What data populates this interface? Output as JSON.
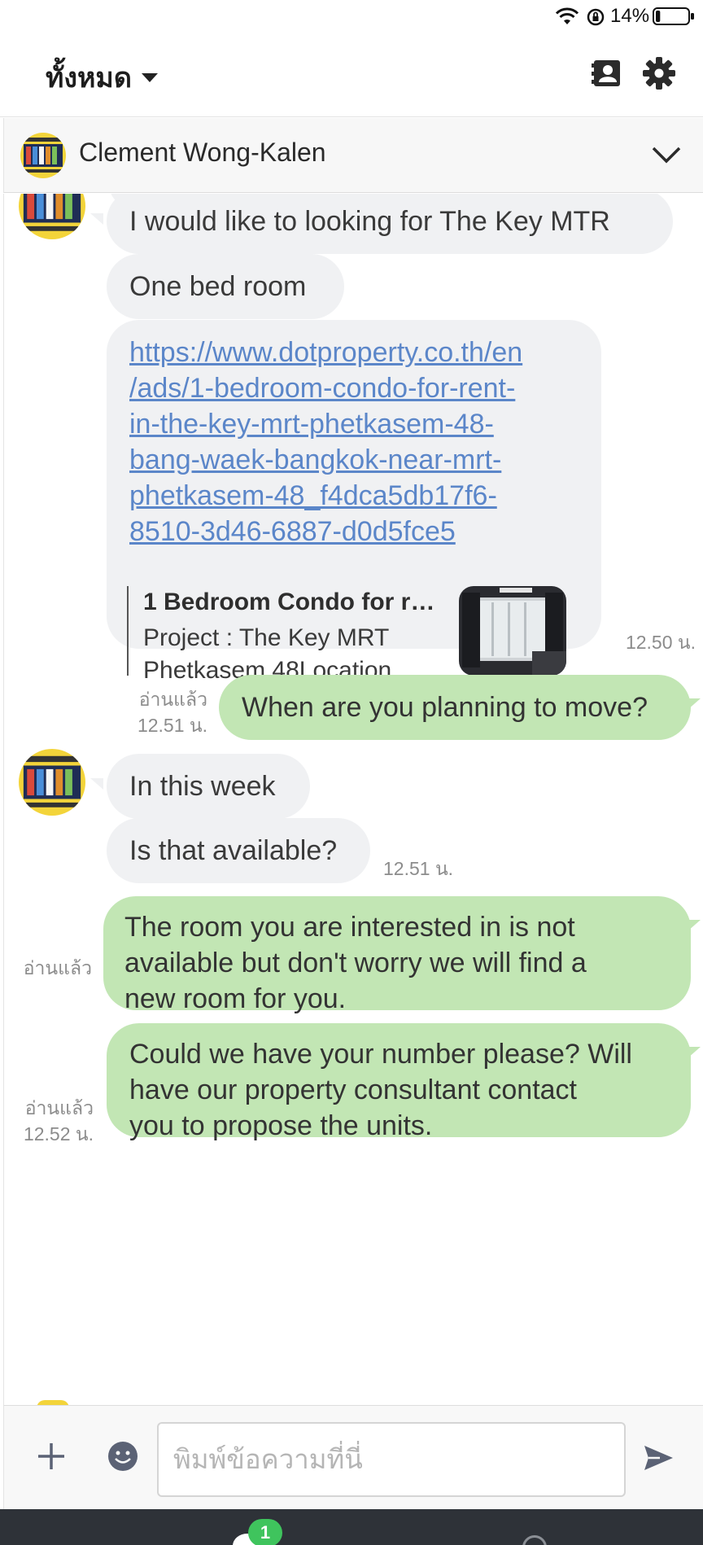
{
  "status_bar": {
    "battery_percent": "14%",
    "battery_level": 0.14
  },
  "header": {
    "filter_label": "ทั้งหมด",
    "icons": [
      "contacts-icon",
      "settings-gear-icon"
    ]
  },
  "conversation": {
    "contact_name": "Clement Wong-Kalen"
  },
  "messages": [
    {
      "side": "in",
      "text": "I would like to looking for The Key MTR"
    },
    {
      "side": "in",
      "text": "One bed room"
    },
    {
      "side": "in",
      "link": "https://www.dotproperty.co.th/en/ads/1-bedroom-condo-for-rent-in-the-key-mrt-phetkasem-48-bang-waek-bangkok-near-mrt-phetkasem-48_f4dca5db17f6-8510-3d46-6887-d0d5fce5",
      "link_lines": [
        "https://www.dotproperty.co.th/en",
        "/ads/1-bedroom-condo-for-rent-",
        "in-the-key-mrt-phetkasem-48-",
        "bang-waek-bangkok-near-mrt-",
        "phetkasem-48_f4dca5db17f6-",
        "8510-3d46-6887-d0d5fce5"
      ],
      "preview_title": "1 Bedroom Condo for r…",
      "preview_desc_1": "Project : The Key MRT",
      "preview_desc_2": "Phetkasem 48Location…",
      "time": "12.50 น."
    },
    {
      "side": "out",
      "text": "When are you planning to move?",
      "read": "อ่านแล้ว",
      "time": "12.51 น."
    },
    {
      "side": "in",
      "text": "In this week"
    },
    {
      "side": "in",
      "text": "Is that available?",
      "time": "12.51 น."
    },
    {
      "side": "out",
      "lines": [
        "The room you are interested in is not",
        "available but don't worry we will find a",
        "new room for you."
      ],
      "read": "อ่านแล้ว"
    },
    {
      "side": "out",
      "lines": [
        "Could we have your number please? Will",
        "have our property consultant contact",
        "you to propose the units."
      ],
      "read": "อ่านแล้ว",
      "time": "12.52 น."
    }
  ],
  "composer": {
    "placeholder": "พิมพ์ข้อความที่นี่"
  },
  "bottom_nav": {
    "chat_badge": "1"
  },
  "colors": {
    "incoming_bubble": "#f0f1f3",
    "outgoing_bubble": "#c2e6b4",
    "link": "#5b86c9",
    "badge": "#3fc45d"
  }
}
